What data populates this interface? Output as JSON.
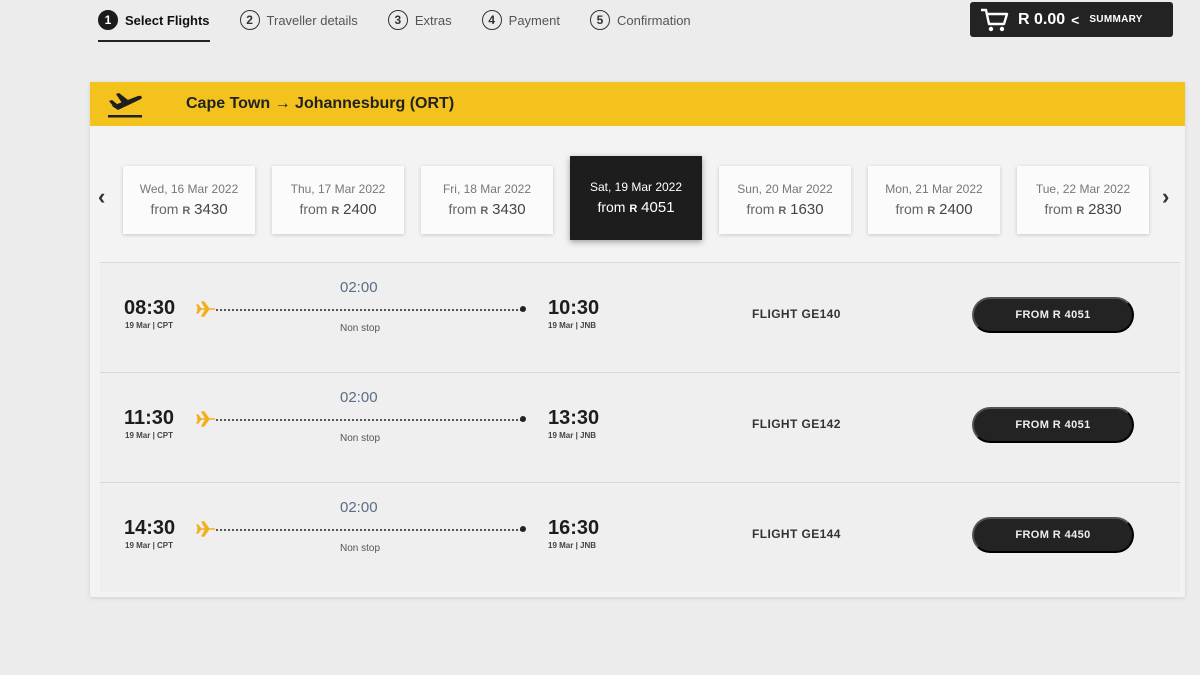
{
  "steps": [
    {
      "num": "1",
      "label": "Select Flights",
      "active": true
    },
    {
      "num": "2",
      "label": "Traveller details"
    },
    {
      "num": "3",
      "label": "Extras"
    },
    {
      "num": "4",
      "label": "Payment"
    },
    {
      "num": "5",
      "label": "Confirmation"
    }
  ],
  "cart": {
    "icon": "cart-icon",
    "amount": "R 0.00",
    "chevron": "<",
    "summary_label": "SUMMARY"
  },
  "route": {
    "icon": "plane-departure-icon",
    "title": "Cape Town → Johannesburg (ORT)"
  },
  "dates": {
    "prev_arrow": "‹",
    "next_arrow": "›",
    "items": [
      {
        "date": "Wed, 16 Mar 2022",
        "from": "from",
        "currency": "R",
        "price": "3430"
      },
      {
        "date": "Thu, 17 Mar 2022",
        "from": "from",
        "currency": "R",
        "price": "2400"
      },
      {
        "date": "Fri, 18 Mar 2022",
        "from": "from",
        "currency": "R",
        "price": "3430"
      },
      {
        "date": "Sat, 19 Mar 2022",
        "from": "from",
        "currency": "R",
        "price": "4051",
        "selected": true
      },
      {
        "date": "Sun, 20 Mar 2022",
        "from": "from",
        "currency": "R",
        "price": "1630"
      },
      {
        "date": "Mon, 21 Mar 2022",
        "from": "from",
        "currency": "R",
        "price": "2400"
      },
      {
        "date": "Tue, 22 Mar 2022",
        "from": "from",
        "currency": "R",
        "price": "2830"
      }
    ]
  },
  "flights": [
    {
      "dep_time": "08:30",
      "dep_sub": "19 Mar | CPT",
      "duration": "02:00",
      "stops": "Non stop",
      "arr_time": "10:30",
      "arr_sub": "19 Mar | JNB",
      "flight_no": "FLIGHT GE140",
      "price_label": "FROM R 4051"
    },
    {
      "dep_time": "11:30",
      "dep_sub": "19 Mar | CPT",
      "duration": "02:00",
      "stops": "Non stop",
      "arr_time": "13:30",
      "arr_sub": "19 Mar | JNB",
      "flight_no": "FLIGHT GE142",
      "price_label": "FROM R 4051"
    },
    {
      "dep_time": "14:30",
      "dep_sub": "19 Mar | CPT",
      "duration": "02:00",
      "stops": "Non stop",
      "arr_time": "16:30",
      "arr_sub": "19 Mar | JNB",
      "flight_no": "FLIGHT GE144",
      "price_label": "FROM R 4450"
    }
  ],
  "colors": {
    "accent_yellow": "#f3c21d",
    "dark": "#232323",
    "plane_orange": "#f2b01e"
  }
}
